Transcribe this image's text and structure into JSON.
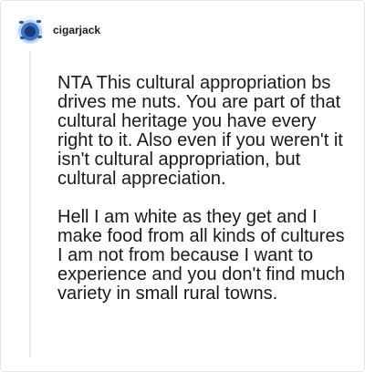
{
  "comment": {
    "username": "cigarjack",
    "avatar_icon": "user-avatar-icon",
    "paragraphs": [
      "NTA This cultural appropriation bs drives me nuts. You are part of that cultural heritage you have every right to it. Also even if you weren't it isn't cultural appropriation, but cultural appreciation.",
      "Hell I am white as they get and I make food from all kinds of cultures I am not from because I want to experience and you don't find much variety in small rural towns."
    ]
  }
}
